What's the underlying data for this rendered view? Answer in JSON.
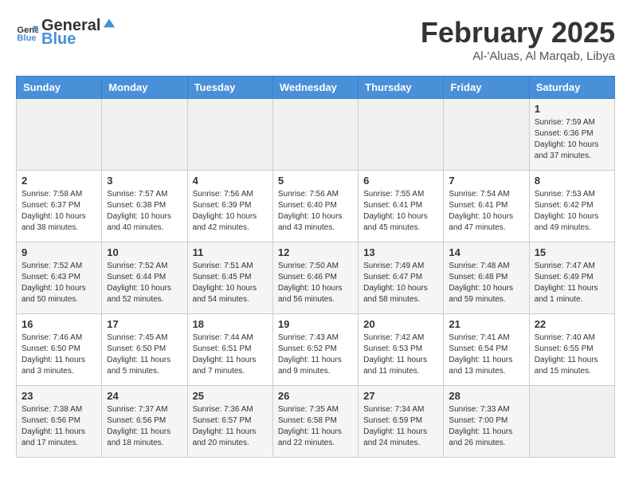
{
  "header": {
    "logo_general": "General",
    "logo_blue": "Blue",
    "month_title": "February 2025",
    "subtitle": "Al-'Aluas, Al Marqab, Libya"
  },
  "days_of_week": [
    "Sunday",
    "Monday",
    "Tuesday",
    "Wednesday",
    "Thursday",
    "Friday",
    "Saturday"
  ],
  "weeks": [
    [
      {
        "day": "",
        "content": ""
      },
      {
        "day": "",
        "content": ""
      },
      {
        "day": "",
        "content": ""
      },
      {
        "day": "",
        "content": ""
      },
      {
        "day": "",
        "content": ""
      },
      {
        "day": "",
        "content": ""
      },
      {
        "day": "1",
        "content": "Sunrise: 7:59 AM\nSunset: 6:36 PM\nDaylight: 10 hours and 37 minutes."
      }
    ],
    [
      {
        "day": "2",
        "content": "Sunrise: 7:58 AM\nSunset: 6:37 PM\nDaylight: 10 hours and 38 minutes."
      },
      {
        "day": "3",
        "content": "Sunrise: 7:57 AM\nSunset: 6:38 PM\nDaylight: 10 hours and 40 minutes."
      },
      {
        "day": "4",
        "content": "Sunrise: 7:56 AM\nSunset: 6:39 PM\nDaylight: 10 hours and 42 minutes."
      },
      {
        "day": "5",
        "content": "Sunrise: 7:56 AM\nSunset: 6:40 PM\nDaylight: 10 hours and 43 minutes."
      },
      {
        "day": "6",
        "content": "Sunrise: 7:55 AM\nSunset: 6:41 PM\nDaylight: 10 hours and 45 minutes."
      },
      {
        "day": "7",
        "content": "Sunrise: 7:54 AM\nSunset: 6:41 PM\nDaylight: 10 hours and 47 minutes."
      },
      {
        "day": "8",
        "content": "Sunrise: 7:53 AM\nSunset: 6:42 PM\nDaylight: 10 hours and 49 minutes."
      }
    ],
    [
      {
        "day": "9",
        "content": "Sunrise: 7:52 AM\nSunset: 6:43 PM\nDaylight: 10 hours and 50 minutes."
      },
      {
        "day": "10",
        "content": "Sunrise: 7:52 AM\nSunset: 6:44 PM\nDaylight: 10 hours and 52 minutes."
      },
      {
        "day": "11",
        "content": "Sunrise: 7:51 AM\nSunset: 6:45 PM\nDaylight: 10 hours and 54 minutes."
      },
      {
        "day": "12",
        "content": "Sunrise: 7:50 AM\nSunset: 6:46 PM\nDaylight: 10 hours and 56 minutes."
      },
      {
        "day": "13",
        "content": "Sunrise: 7:49 AM\nSunset: 6:47 PM\nDaylight: 10 hours and 58 minutes."
      },
      {
        "day": "14",
        "content": "Sunrise: 7:48 AM\nSunset: 6:48 PM\nDaylight: 10 hours and 59 minutes."
      },
      {
        "day": "15",
        "content": "Sunrise: 7:47 AM\nSunset: 6:49 PM\nDaylight: 11 hours and 1 minute."
      }
    ],
    [
      {
        "day": "16",
        "content": "Sunrise: 7:46 AM\nSunset: 6:50 PM\nDaylight: 11 hours and 3 minutes."
      },
      {
        "day": "17",
        "content": "Sunrise: 7:45 AM\nSunset: 6:50 PM\nDaylight: 11 hours and 5 minutes."
      },
      {
        "day": "18",
        "content": "Sunrise: 7:44 AM\nSunset: 6:51 PM\nDaylight: 11 hours and 7 minutes."
      },
      {
        "day": "19",
        "content": "Sunrise: 7:43 AM\nSunset: 6:52 PM\nDaylight: 11 hours and 9 minutes."
      },
      {
        "day": "20",
        "content": "Sunrise: 7:42 AM\nSunset: 6:53 PM\nDaylight: 11 hours and 11 minutes."
      },
      {
        "day": "21",
        "content": "Sunrise: 7:41 AM\nSunset: 6:54 PM\nDaylight: 11 hours and 13 minutes."
      },
      {
        "day": "22",
        "content": "Sunrise: 7:40 AM\nSunset: 6:55 PM\nDaylight: 11 hours and 15 minutes."
      }
    ],
    [
      {
        "day": "23",
        "content": "Sunrise: 7:38 AM\nSunset: 6:56 PM\nDaylight: 11 hours and 17 minutes."
      },
      {
        "day": "24",
        "content": "Sunrise: 7:37 AM\nSunset: 6:56 PM\nDaylight: 11 hours and 18 minutes."
      },
      {
        "day": "25",
        "content": "Sunrise: 7:36 AM\nSunset: 6:57 PM\nDaylight: 11 hours and 20 minutes."
      },
      {
        "day": "26",
        "content": "Sunrise: 7:35 AM\nSunset: 6:58 PM\nDaylight: 11 hours and 22 minutes."
      },
      {
        "day": "27",
        "content": "Sunrise: 7:34 AM\nSunset: 6:59 PM\nDaylight: 11 hours and 24 minutes."
      },
      {
        "day": "28",
        "content": "Sunrise: 7:33 AM\nSunset: 7:00 PM\nDaylight: 11 hours and 26 minutes."
      },
      {
        "day": "",
        "content": ""
      }
    ]
  ]
}
